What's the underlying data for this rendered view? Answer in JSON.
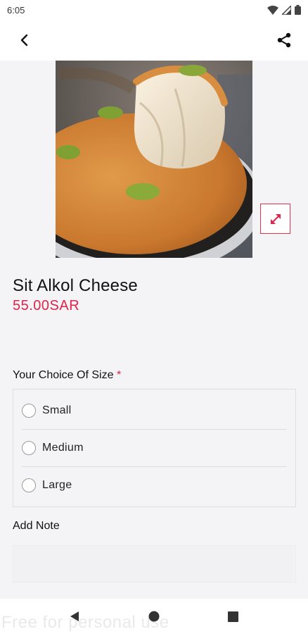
{
  "status_bar": {
    "time": "6:05",
    "icons": [
      "wifi-icon",
      "signal-icon",
      "battery-icon"
    ]
  },
  "app_bar": {
    "back_icon": "back-arrow-icon",
    "share_icon": "share-icon"
  },
  "product": {
    "name": "Sit Alkol Cheese",
    "price": "55.00SAR",
    "image_description_icon": "kunafa-photo",
    "expand_icon": "expand-arrows-icon"
  },
  "size_section": {
    "title": "Your Choice Of Size",
    "required_mark": "*",
    "options": [
      {
        "label": "Small"
      },
      {
        "label": "Medium"
      },
      {
        "label": "Large"
      }
    ]
  },
  "note_section": {
    "title": "Add Note",
    "value": "",
    "placeholder": ""
  },
  "nav_bar": {
    "icons": [
      "back-triangle-icon",
      "home-circle-icon",
      "recents-square-icon"
    ]
  },
  "watermark": "Free for personal use",
  "colors": {
    "accent": "#e0244a",
    "background": "#f4f4f6",
    "surface": "#ffffff"
  }
}
